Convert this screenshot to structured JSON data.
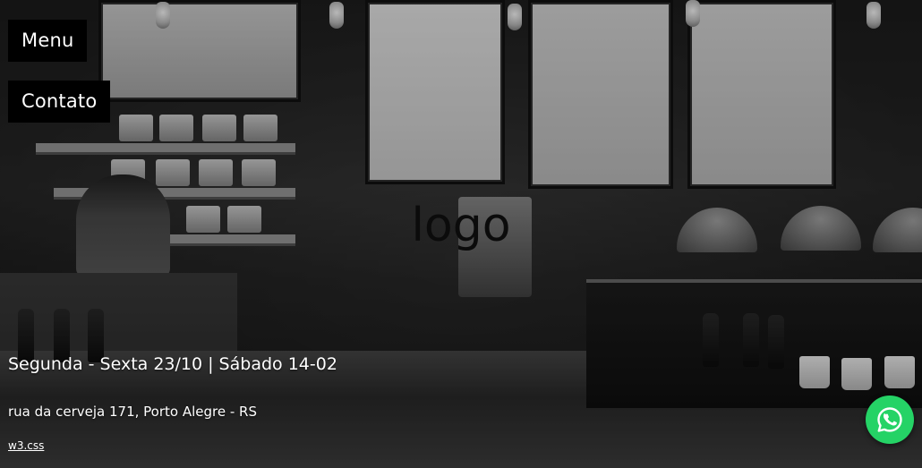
{
  "nav": {
    "menu_label": "Menu",
    "contact_label": "Contato"
  },
  "hero": {
    "logo_text": "logo",
    "hours": "Segunda - Sexta 23/10 | Sábado 14-02",
    "address": "rua da cerveja 171, Porto Alegre - RS",
    "credit_link": "w3.css"
  },
  "floating_button": {
    "icon": "whatsapp-icon",
    "color": "#25d366"
  },
  "colors": {
    "nav_bg": "#000000",
    "nav_text": "#ffffff",
    "logo_text": "#0b0b0b"
  }
}
